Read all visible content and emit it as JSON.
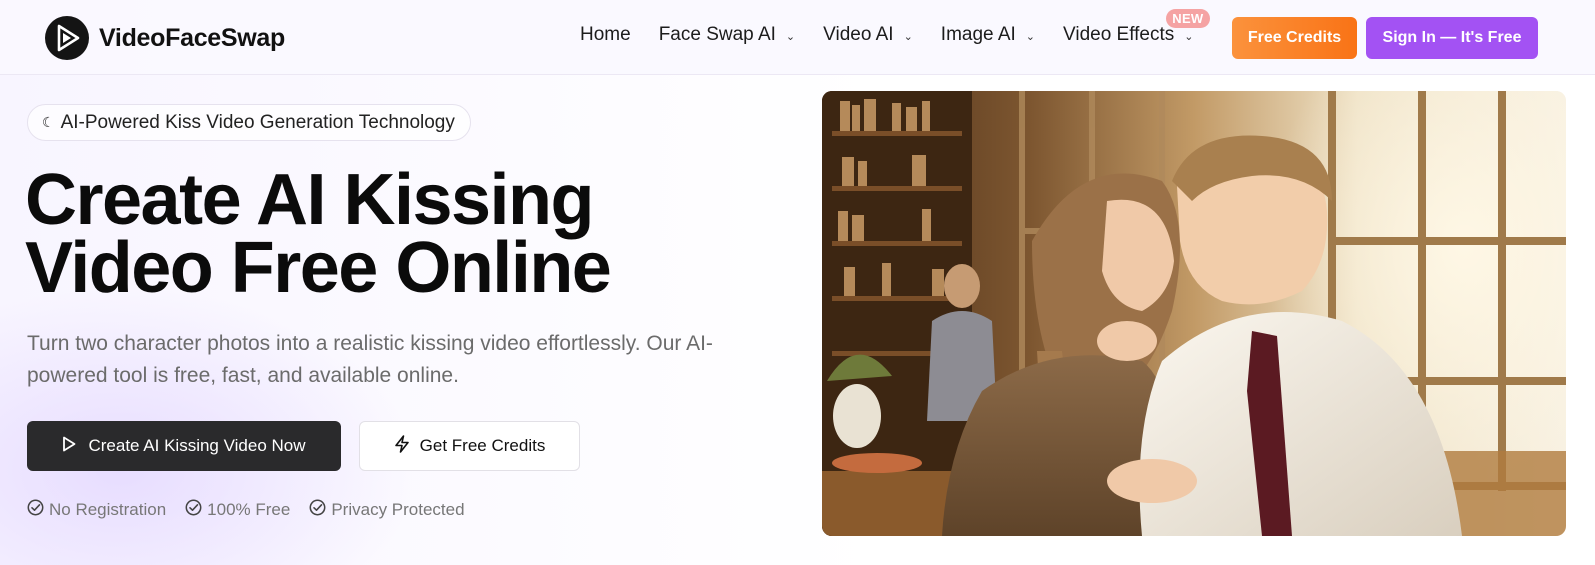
{
  "header": {
    "brand": "VideoFaceSwap",
    "logo_icon": "play-face-logo-icon",
    "nav": [
      {
        "label": "Home",
        "has_dropdown": false
      },
      {
        "label": "Face Swap AI",
        "has_dropdown": true
      },
      {
        "label": "Video AI",
        "has_dropdown": true
      },
      {
        "label": "Image AI",
        "has_dropdown": true
      },
      {
        "label": "Video Effects",
        "has_dropdown": true,
        "badge": "NEW"
      }
    ],
    "free_credits_label": "Free Credits",
    "sign_in_label": "Sign In — It's Free"
  },
  "hero": {
    "pill_label": "AI-Powered Kiss Video Generation Technology",
    "pill_icon": "moon-icon",
    "title_line1": "Create AI Kissing",
    "title_line2": "Video Free Online",
    "subtitle": "Turn two character photos into a realistic kissing video effortlessly. Our AI-powered tool is free, fast, and available online.",
    "primary_button": "Create AI Kissing Video Now",
    "primary_icon": "play-icon",
    "secondary_button": "Get Free Credits",
    "secondary_icon": "lightning-icon",
    "features": [
      {
        "label": "No Registration",
        "icon": "check-circle-icon"
      },
      {
        "label": "100% Free",
        "icon": "check-circle-icon"
      },
      {
        "label": "Privacy Protected",
        "icon": "check-circle-icon"
      }
    ]
  },
  "colors": {
    "orange_accent": "#f97316",
    "purple_accent": "#a352f3",
    "dark_button": "#2a2a2c",
    "badge_pink": "#f5a3a3"
  }
}
